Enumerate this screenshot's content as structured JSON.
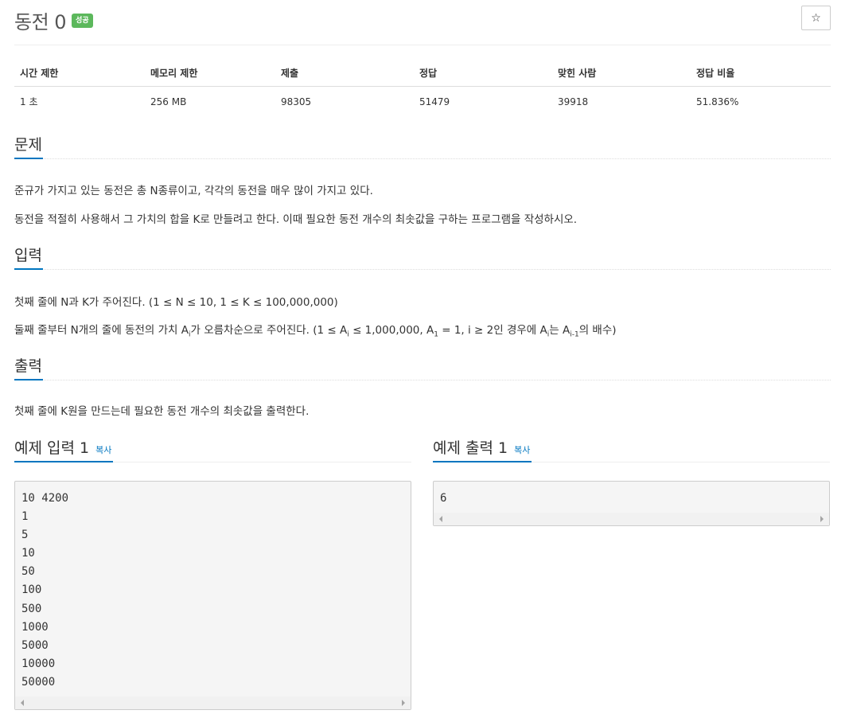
{
  "header": {
    "title": "동전 0",
    "badge": "성공",
    "star_icon": "☆"
  },
  "info_table": {
    "headers": [
      "시간 제한",
      "메모리 제한",
      "제출",
      "정답",
      "맞힌 사람",
      "정답 비율"
    ],
    "values": [
      "1 초",
      "256 MB",
      "98305",
      "51479",
      "39918",
      "51.836%"
    ]
  },
  "problem": {
    "heading": "문제",
    "p1": "준규가 가지고 있는 동전은 총 N종류이고, 각각의 동전을 매우 많이 가지고 있다.",
    "p2": "동전을 적절히 사용해서 그 가치의 합을 K로 만들려고 한다. 이때 필요한 동전 개수의 최솟값을 구하는 프로그램을 작성하시오."
  },
  "input": {
    "heading": "입력",
    "p1": "첫째 줄에 N과 K가 주어진다. (1 ≤ N ≤ 10, 1 ≤ K ≤ 100,000,000)",
    "p2": {
      "t1": "둘째 줄부터 N개의 줄에 동전의 가치 A",
      "s1": "i",
      "t2": "가 오름차순으로 주어진다. (1 ≤ A",
      "s2": "i",
      "t3": " ≤ 1,000,000, A",
      "s3": "1",
      "t4": " = 1, i ≥ 2인 경우에 A",
      "s4": "i",
      "t5": "는 A",
      "s5": "i-1",
      "t6": "의 배수)"
    }
  },
  "output": {
    "heading": "출력",
    "p1": "첫째 줄에 K원을 만드는데 필요한 동전 개수의 최솟값을 출력한다."
  },
  "sample_input": {
    "heading": "예제 입력 1",
    "copy": "복사",
    "lines": [
      "10 4200",
      "1",
      "5",
      "10",
      "50",
      "100",
      "500",
      "1000",
      "5000",
      "10000",
      "50000"
    ]
  },
  "sample_output": {
    "heading": "예제 출력 1",
    "copy": "복사",
    "lines": [
      "6"
    ]
  },
  "colors": {
    "accent": "#0076c0",
    "badge": "#5cb85c"
  }
}
